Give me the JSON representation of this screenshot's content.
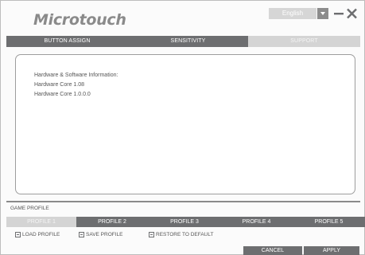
{
  "header": {
    "logo_text": "Microtouch",
    "language": "English"
  },
  "tabs": [
    {
      "label": "BUTTON ASSIGN",
      "active": false
    },
    {
      "label": "SENSITIVITY",
      "active": false
    },
    {
      "label": "SUPPORT",
      "active": true
    }
  ],
  "info": {
    "heading": "Hardware & Software Information:",
    "lines": [
      "Hardware Core 1.08",
      "Hardware Core 1.0.0.0"
    ]
  },
  "game_profile": {
    "label": "GAME PROFILE",
    "profiles": [
      {
        "label": "PROFILE 1",
        "active": true
      },
      {
        "label": "PROFILE 2",
        "active": false
      },
      {
        "label": "PROFILE 3",
        "active": false
      },
      {
        "label": "PROFILE 4",
        "active": false
      },
      {
        "label": "PROFILE 5",
        "active": false
      }
    ],
    "actions": {
      "load": "LOAD PROFILE",
      "save": "SAVE PROFILE",
      "restore": "RESTORE TO DEFAULT"
    }
  },
  "buttons": {
    "cancel": "CANCEL",
    "apply": "APPLY"
  },
  "colors": {
    "tab_bar": "#6d6e70",
    "active_tab": "#d4d4d4",
    "logo": "#8a8a8a"
  },
  "icons": {
    "language_dropdown": "chevron-down-icon",
    "minimize": "minimize-icon",
    "close": "close-icon"
  }
}
